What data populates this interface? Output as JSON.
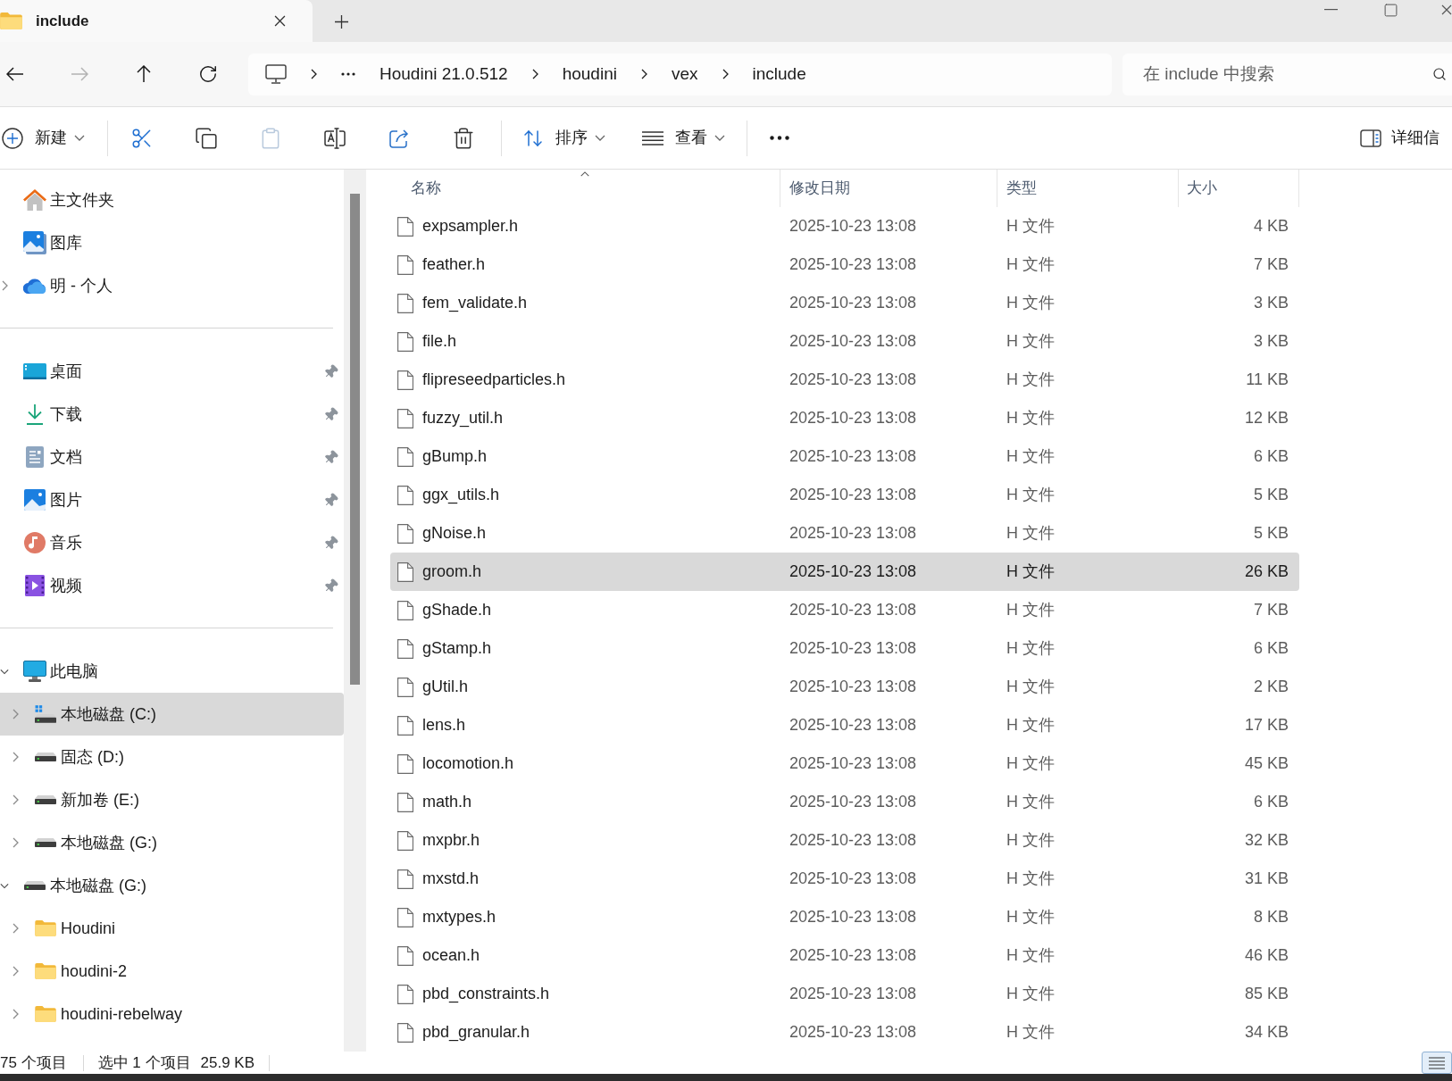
{
  "tabs": [
    {
      "title": "include",
      "selected": true
    }
  ],
  "navigation": [
    {
      "disabled": false
    },
    {
      "disabled": true
    },
    {
      "disabled": false
    },
    {
      "disabled": false
    }
  ],
  "address_bar": {
    "segments": [
      "Houdini 21.0.512",
      "houdini",
      "vex",
      "include"
    ]
  },
  "search": {
    "placeholder": "在 include 中搜索"
  },
  "toolbar": {
    "new_button": {
      "label": "新建"
    },
    "actions": [
      {
        "disabled": false
      },
      {
        "disabled": false
      },
      {
        "disabled": true
      },
      {
        "disabled": false
      },
      {
        "disabled": false
      },
      {
        "disabled": false
      }
    ],
    "sort_button": {
      "label": "排序"
    },
    "view_button": {
      "label": "查看"
    },
    "details_button": {
      "label": "详细信"
    }
  },
  "sidebar": {
    "top": [
      {
        "label": "主文件夹",
        "expandable": false,
        "selected": false
      },
      {
        "label": "图库",
        "expandable": false,
        "selected": false
      },
      {
        "label": "明 - 个人",
        "expandable": true,
        "expanded": false,
        "selected": false
      }
    ],
    "pinned": [
      {
        "label": "桌面",
        "pinned": true,
        "selected": false
      },
      {
        "label": "下载",
        "pinned": true,
        "selected": false
      },
      {
        "label": "文档",
        "pinned": true,
        "selected": false
      },
      {
        "label": "图片",
        "pinned": true,
        "selected": false
      },
      {
        "label": "音乐",
        "pinned": true,
        "selected": false
      },
      {
        "label": "视频",
        "pinned": true,
        "selected": false
      }
    ],
    "tree": [
      {
        "label": "此电脑",
        "kind": "computer",
        "expanded": true,
        "selected": false,
        "children": [
          {
            "label": "本地磁盘 (C:)",
            "kind": "system_drive",
            "expanded": false,
            "selected": true
          },
          {
            "label": "固态 (D:)",
            "kind": "drive",
            "expanded": false,
            "selected": false
          },
          {
            "label": "新加卷 (E:)",
            "kind": "drive",
            "expanded": false,
            "selected": false
          },
          {
            "label": "本地磁盘 (G:)",
            "kind": "drive",
            "expanded": false,
            "selected": false
          }
        ]
      },
      {
        "label": "本地磁盘 (G:)",
        "kind": "drive",
        "expanded": true,
        "selected": false,
        "children": [
          {
            "label": "Houdini",
            "kind": "folder",
            "expanded": false,
            "selected": false
          },
          {
            "label": "houdini-2",
            "kind": "folder",
            "expanded": false,
            "selected": false
          },
          {
            "label": "houdini-rebelway",
            "kind": "folder",
            "expanded": false,
            "selected": false
          }
        ]
      }
    ]
  },
  "file_list": {
    "columns": [
      {
        "label": "名称",
        "sorted": true
      },
      {
        "label": "修改日期",
        "sorted": false
      },
      {
        "label": "类型",
        "sorted": false
      },
      {
        "label": "大小",
        "sorted": false
      }
    ],
    "rows": [
      {
        "name": "expsampler.h",
        "modified": "2025-10-23 13:08",
        "type": "H 文件",
        "size": "4 KB",
        "selected": false
      },
      {
        "name": "feather.h",
        "modified": "2025-10-23 13:08",
        "type": "H 文件",
        "size": "7 KB",
        "selected": false
      },
      {
        "name": "fem_validate.h",
        "modified": "2025-10-23 13:08",
        "type": "H 文件",
        "size": "3 KB",
        "selected": false
      },
      {
        "name": "file.h",
        "modified": "2025-10-23 13:08",
        "type": "H 文件",
        "size": "3 KB",
        "selected": false
      },
      {
        "name": "flipreseedparticles.h",
        "modified": "2025-10-23 13:08",
        "type": "H 文件",
        "size": "11 KB",
        "selected": false
      },
      {
        "name": "fuzzy_util.h",
        "modified": "2025-10-23 13:08",
        "type": "H 文件",
        "size": "12 KB",
        "selected": false
      },
      {
        "name": "gBump.h",
        "modified": "2025-10-23 13:08",
        "type": "H 文件",
        "size": "6 KB",
        "selected": false
      },
      {
        "name": "ggx_utils.h",
        "modified": "2025-10-23 13:08",
        "type": "H 文件",
        "size": "5 KB",
        "selected": false
      },
      {
        "name": "gNoise.h",
        "modified": "2025-10-23 13:08",
        "type": "H 文件",
        "size": "5 KB",
        "selected": false
      },
      {
        "name": "groom.h",
        "modified": "2025-10-23 13:08",
        "type": "H 文件",
        "size": "26 KB",
        "selected": true
      },
      {
        "name": "gShade.h",
        "modified": "2025-10-23 13:08",
        "type": "H 文件",
        "size": "7 KB",
        "selected": false
      },
      {
        "name": "gStamp.h",
        "modified": "2025-10-23 13:08",
        "type": "H 文件",
        "size": "6 KB",
        "selected": false
      },
      {
        "name": "gUtil.h",
        "modified": "2025-10-23 13:08",
        "type": "H 文件",
        "size": "2 KB",
        "selected": false
      },
      {
        "name": "lens.h",
        "modified": "2025-10-23 13:08",
        "type": "H 文件",
        "size": "17 KB",
        "selected": false
      },
      {
        "name": "locomotion.h",
        "modified": "2025-10-23 13:08",
        "type": "H 文件",
        "size": "45 KB",
        "selected": false
      },
      {
        "name": "math.h",
        "modified": "2025-10-23 13:08",
        "type": "H 文件",
        "size": "6 KB",
        "selected": false
      },
      {
        "name": "mxpbr.h",
        "modified": "2025-10-23 13:08",
        "type": "H 文件",
        "size": "32 KB",
        "selected": false
      },
      {
        "name": "mxstd.h",
        "modified": "2025-10-23 13:08",
        "type": "H 文件",
        "size": "31 KB",
        "selected": false
      },
      {
        "name": "mxtypes.h",
        "modified": "2025-10-23 13:08",
        "type": "H 文件",
        "size": "8 KB",
        "selected": false
      },
      {
        "name": "ocean.h",
        "modified": "2025-10-23 13:08",
        "type": "H 文件",
        "size": "46 KB",
        "selected": false
      },
      {
        "name": "pbd_constraints.h",
        "modified": "2025-10-23 13:08",
        "type": "H 文件",
        "size": "85 KB",
        "selected": false
      },
      {
        "name": "pbd_granular.h",
        "modified": "2025-10-23 13:08",
        "type": "H 文件",
        "size": "34 KB",
        "selected": false
      }
    ]
  },
  "status_bar": {
    "item_count": "75 个项目",
    "selection": "选中 1 个项目",
    "selection_size": "25.9 KB",
    "view_buttons": [
      {
        "selected": true
      }
    ]
  }
}
